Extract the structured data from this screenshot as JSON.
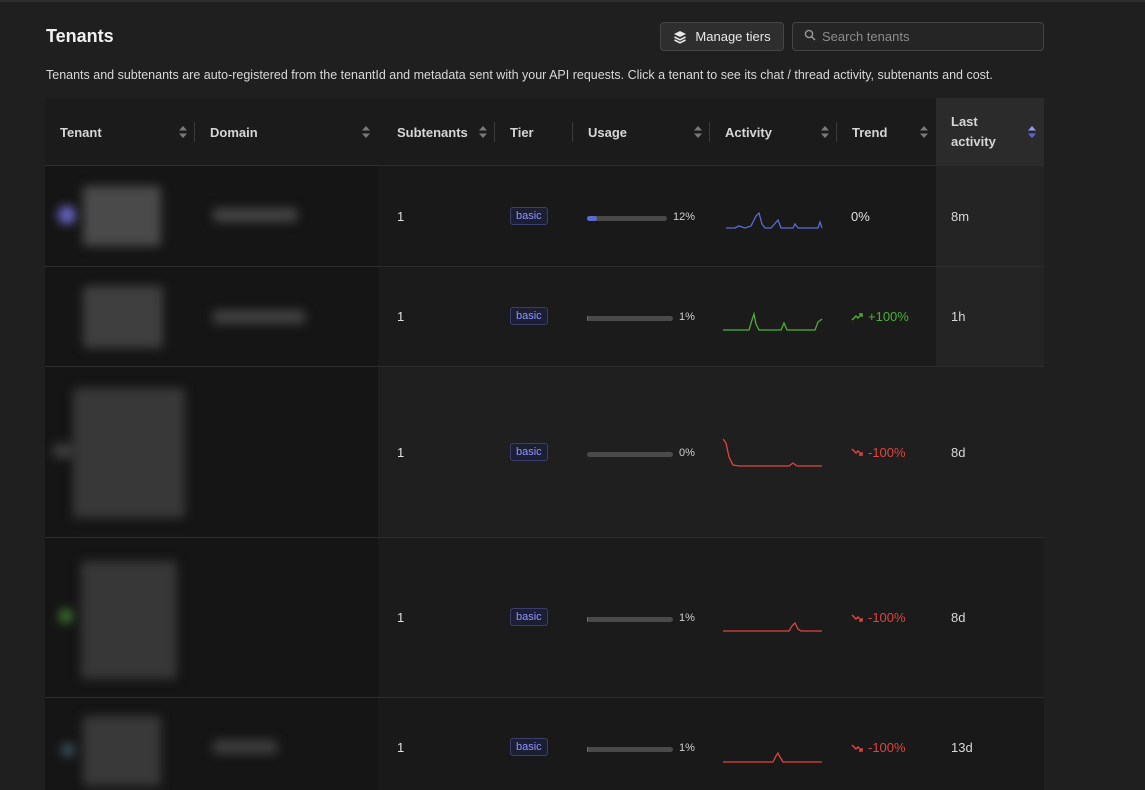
{
  "header": {
    "title": "Tenants",
    "manage_tiers_label": "Manage tiers",
    "search_placeholder": "Search tenants",
    "description": "Tenants and subtenants are auto-registered from the tenantId and metadata sent with your API requests. Click a tenant to see its chat / thread activity, subtenants and cost."
  },
  "table": {
    "columns": {
      "tenant": "Tenant",
      "domain": "Domain",
      "subtenants": "Subtenants",
      "tier": "Tier",
      "usage": "Usage",
      "activity": "Activity",
      "trend": "Trend",
      "last_activity_line1": "Last",
      "last_activity_line2": "activity"
    },
    "sorted_column": "last_activity",
    "rows": [
      {
        "subtenants": "1",
        "tier": "basic",
        "usage": 0.12,
        "usage_label": "12%",
        "trend": "0%",
        "trend_dir": "flat",
        "last_activity": "8m",
        "spark_color": "#5b6bd6"
      },
      {
        "subtenants": "1",
        "tier": "basic",
        "usage": 0.01,
        "usage_label": "1%",
        "trend": "+100%",
        "trend_dir": "up",
        "last_activity": "1h",
        "spark_color": "#4caf35"
      },
      {
        "subtenants": "1",
        "tier": "basic",
        "usage": 0.0,
        "usage_label": "0%",
        "trend": "-100%",
        "trend_dir": "down",
        "last_activity": "8d",
        "spark_color": "#e0443f"
      },
      {
        "subtenants": "1",
        "tier": "basic",
        "usage": 0.01,
        "usage_label": "1%",
        "trend": "-100%",
        "trend_dir": "down",
        "last_activity": "8d",
        "spark_color": "#e0443f"
      },
      {
        "subtenants": "1",
        "tier": "basic",
        "usage": 0.01,
        "usage_label": "1%",
        "trend": "-100%",
        "trend_dir": "down",
        "last_activity": "13d",
        "spark_color": "#e0443f"
      }
    ]
  },
  "colors": {
    "accent": "#5b6bd6",
    "trend_up": "#4caf35",
    "trend_down": "#e0443f"
  }
}
